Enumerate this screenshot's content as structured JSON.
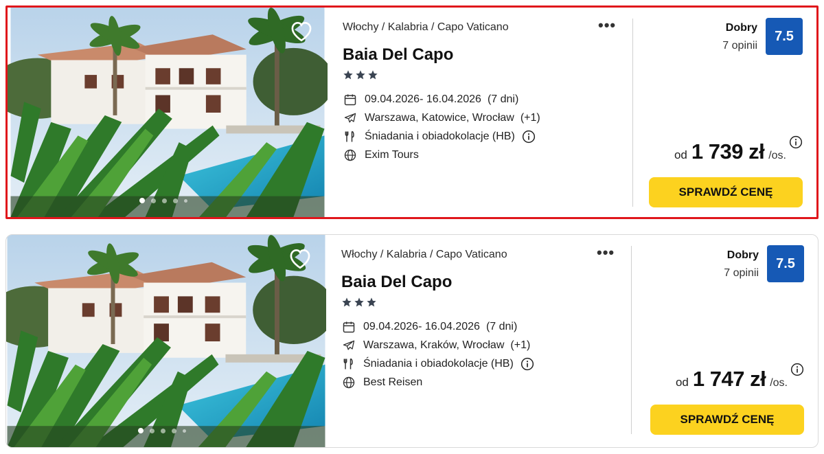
{
  "colors": {
    "accent": "#fcd21f",
    "rating_bg": "#1659b5",
    "highlight": "#e0161b"
  },
  "offers": [
    {
      "breadcrumb": "Włochy / Kalabria / Capo Vaticano",
      "more_label": "•••",
      "hotel_name": "Baia Del Capo",
      "stars": 3,
      "dates": "09.04.2026- 16.04.2026",
      "duration": "(7 dni)",
      "departures": "Warszawa, Katowice, Wrocław",
      "departures_more": "(+1)",
      "board": "Śniadania i obiadokolacje (HB)",
      "operator": "Exim Tours",
      "rating_word": "Dobry",
      "reviews": "7 opinii",
      "rating": "7.5",
      "price_prefix": "od",
      "price": "1 739 zł",
      "price_suffix": "/os.",
      "cta": "SPRAWDŹ CENĘ",
      "photo_slides": 5,
      "active_slide": 1,
      "highlighted": true
    },
    {
      "breadcrumb": "Włochy / Kalabria / Capo Vaticano",
      "more_label": "•••",
      "hotel_name": "Baia Del Capo",
      "stars": 3,
      "dates": "09.04.2026- 16.04.2026",
      "duration": "(7 dni)",
      "departures": "Warszawa, Kraków, Wrocław",
      "departures_more": "(+1)",
      "board": "Śniadania i obiadokolacje (HB)",
      "operator": "Best Reisen",
      "rating_word": "Dobry",
      "reviews": "7 opinii",
      "rating": "7.5",
      "price_prefix": "od",
      "price": "1 747 zł",
      "price_suffix": "/os.",
      "cta": "SPRAWDŹ CENĘ",
      "photo_slides": 5,
      "active_slide": 1,
      "highlighted": false
    }
  ],
  "icons": {
    "favorite": "heart-outline-icon",
    "dates": "calendar-icon",
    "departures": "plane-icon",
    "board": "cutlery-icon",
    "operator": "globe-icon",
    "info": "info-circle-icon",
    "rating": "star-icon"
  }
}
